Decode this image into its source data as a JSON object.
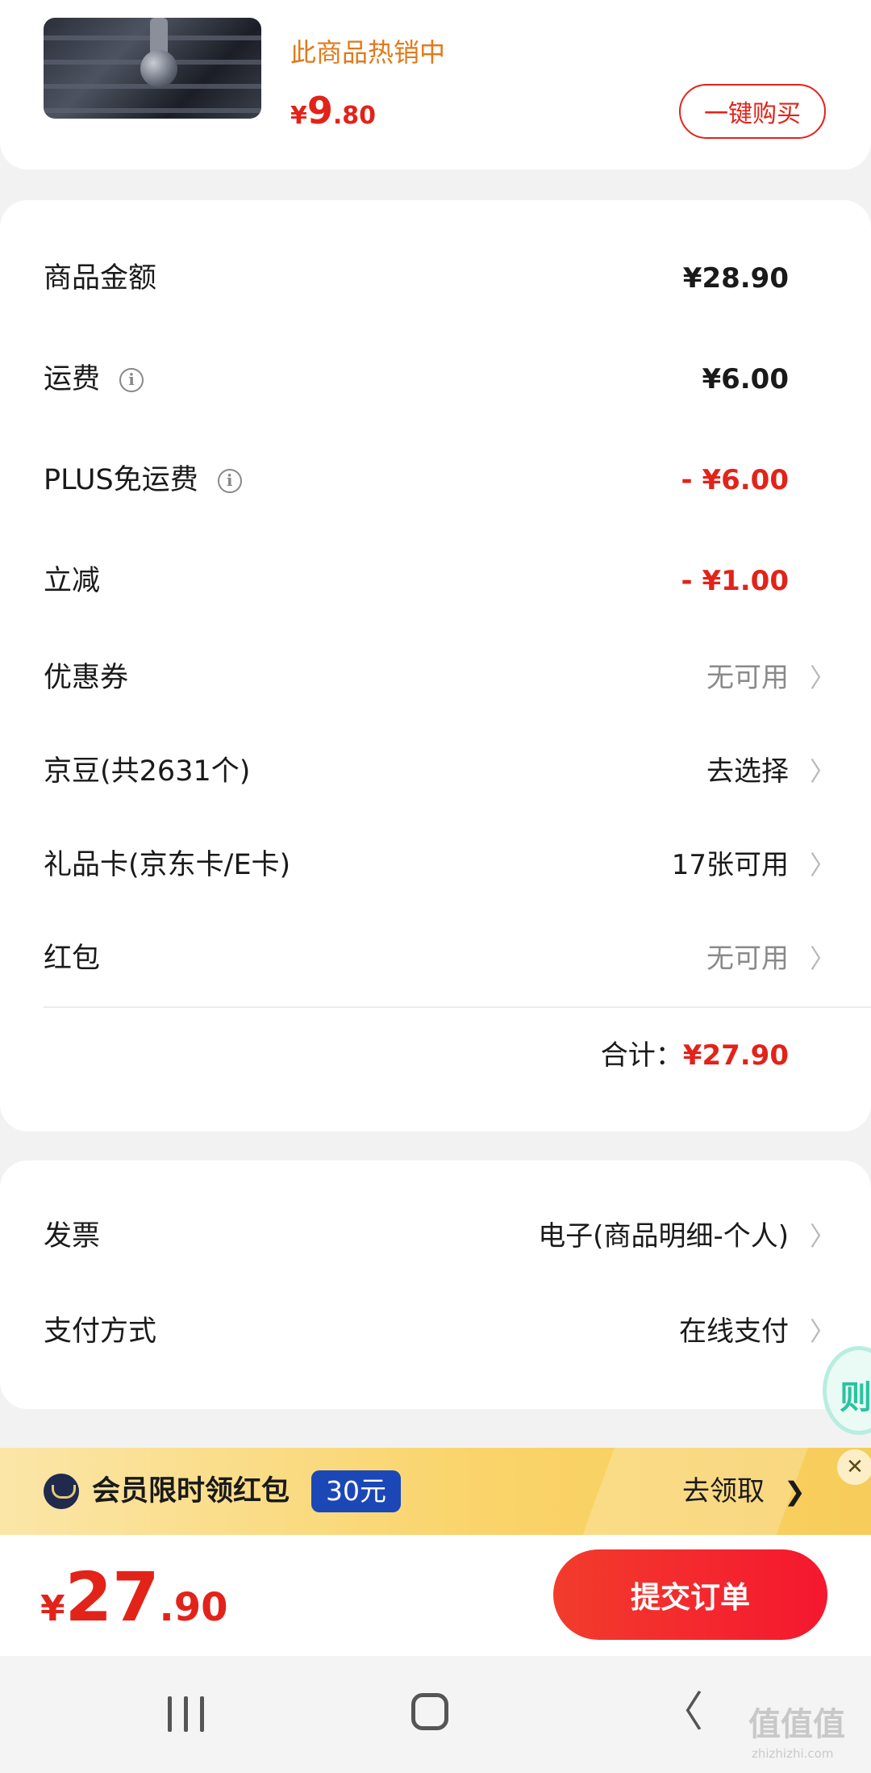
{
  "product": {
    "hot_label": "此商品热销中",
    "price_currency": "¥",
    "price_int": "9",
    "price_dec": ".80",
    "buy_button": "一键购买"
  },
  "summary": {
    "rows": [
      {
        "label": "商品金额",
        "value": "¥28.90"
      },
      {
        "label": "运费",
        "value": "¥6.00"
      },
      {
        "label": "PLUS免运费",
        "value": "- ¥6.00"
      },
      {
        "label": "立减",
        "value": "- ¥1.00"
      },
      {
        "label": "优惠券",
        "value": "无可用"
      },
      {
        "label": "京豆(共2631个)",
        "value": "去选择"
      },
      {
        "label": "礼品卡(京东卡/E卡)",
        "value": "17张可用"
      },
      {
        "label": "红包",
        "value": "无可用"
      }
    ],
    "total_label": "合计：",
    "total_value": "¥27.90"
  },
  "invoice": {
    "rows": [
      {
        "label": "发票",
        "value": "电子(商品明细-个人)"
      },
      {
        "label": "支付方式",
        "value": "在线支付"
      }
    ]
  },
  "floating_icon": {
    "glyph": "则"
  },
  "banner": {
    "text": "会员限时领红包",
    "badge": "30元",
    "action": "去领取",
    "chevron": "❯",
    "close": "✕"
  },
  "bottom": {
    "currency": "¥",
    "int": "27",
    "dec": ".90",
    "submit": "提交订单"
  },
  "chevron": "〉",
  "nav": {
    "back": "〈"
  },
  "watermark": {
    "text": "值值值",
    "sub": "zhizhizhi.com"
  },
  "colors": {
    "accent": "#e2231a",
    "hot": "#e07a1a",
    "badge": "#1c47b6",
    "banner": "#fad46a"
  }
}
